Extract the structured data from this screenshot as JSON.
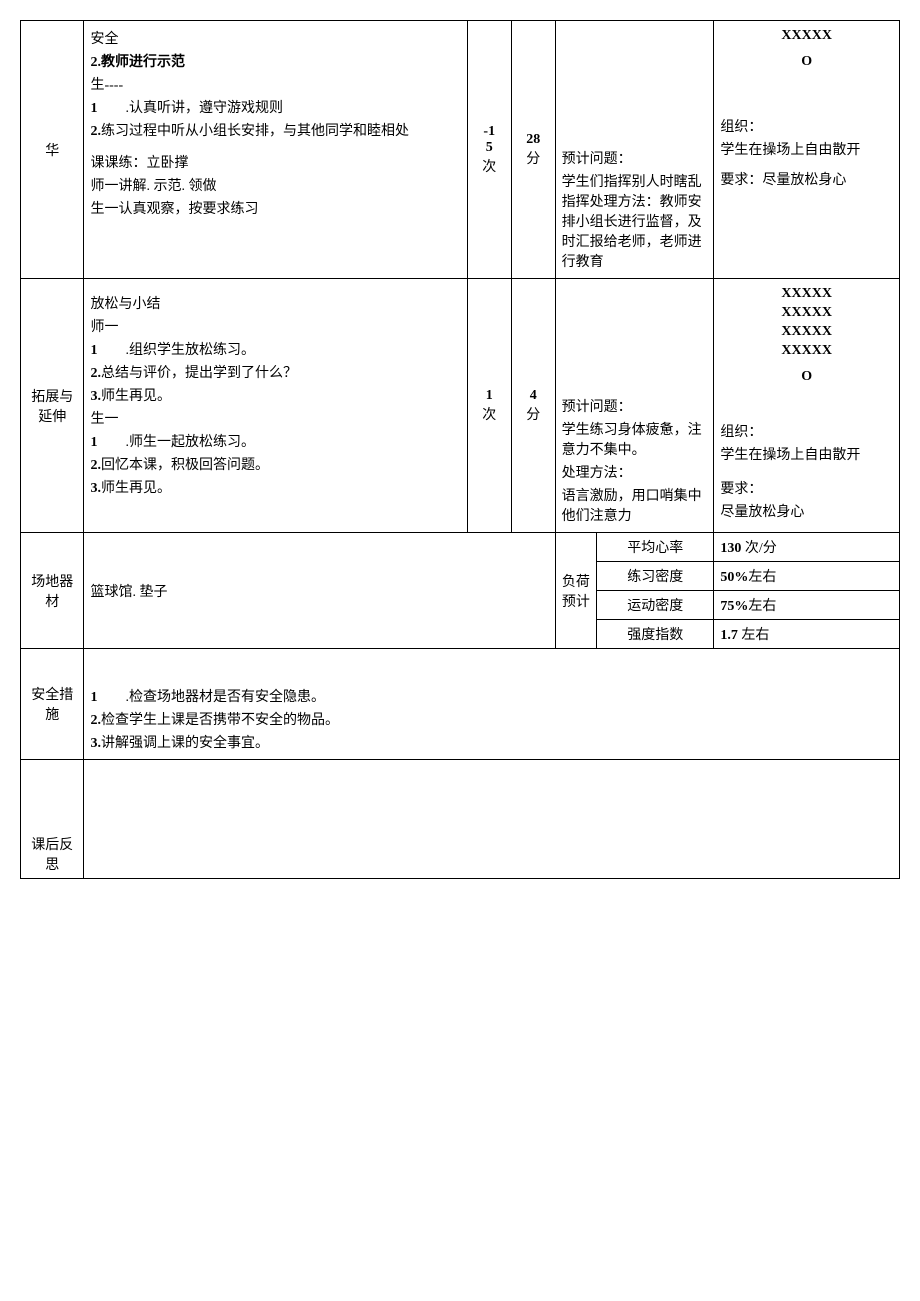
{
  "row1": {
    "label": "华",
    "content_l1": "安全",
    "content_l2": "2.教师进行示范",
    "content_l3": "生----",
    "content_l4": "1         .认真听讲，遵守游戏规则",
    "content_l5": "2.练习过程中听从小组长安排，与其他同学和睦相处",
    "content_l6": "课课练：立卧撑",
    "content_l7": "师一讲解. 示范. 领做",
    "content_l8": "生一认真观察，按要求练习",
    "times_a": "-1",
    "times_b": "5",
    "times_c": "次",
    "mins_a": "28",
    "mins_b": "分",
    "prob_l1": "预计问题：",
    "prob_l2": "学生们指挥别人时瞎乱指挥处理方法：教师安排小组长进行监督，及时汇报给老师，老师进行教育",
    "org_sym1": "XXXXX",
    "org_sym2": "O",
    "org_l1": "组织：",
    "org_l2": "学生在操场上自由散开",
    "org_l3": "要求：尽量放松身心"
  },
  "row2": {
    "label": "拓展与延伸",
    "content_l1": "放松与小结",
    "content_l2": "师一",
    "content_l3": "1         .组织学生放松练习。",
    "content_l4": "2.总结与评价，提出学到了什么？",
    "content_l5": "3.师生再见。",
    "content_l6": "生一",
    "content_l7": "1         .师生一起放松练习。",
    "content_l8": "2.回忆本课，积极回答问题。",
    "content_l9": "3.师生再见。",
    "times_a": "1",
    "times_b": "次",
    "mins_a": "4",
    "mins_b": "分",
    "prob_l1": "预计问题：",
    "prob_l2": "学生练习身体疲惫，注意力不集中。",
    "prob_l3": "处理方法：",
    "prob_l4": "语言激励，用口哨集中他们注意力",
    "org_sym1": "XXXXX",
    "org_sym2": "XXXXX",
    "org_sym3": "XXXXX",
    "org_sym4": "XXXXX",
    "org_sym5": "O",
    "org_l1": "组织：",
    "org_l2": "学生在操场上自由散开",
    "org_l3": "要求：",
    "org_l4": "尽量放松身心"
  },
  "row3": {
    "label": "场地器材",
    "content": "篮球馆. 垫子",
    "load_label": "负荷预计",
    "m1_label": "平均心率",
    "m1_val": "130 次/分",
    "m2_label": "练习密度",
    "m2_val": "50%左右",
    "m3_label": "运动密度",
    "m3_val": "75%左右",
    "m4_label": "强度指数",
    "m4_val": "1.7 左右"
  },
  "row4": {
    "label": "安全措施",
    "l1": "1         .检查场地器材是否有安全隐患。",
    "l2": "2.检查学生上课是否携带不安全的物品。",
    "l3": "3.讲解强调上课的安全事宜。"
  },
  "row5": {
    "label": "课后反思",
    "content": ""
  }
}
